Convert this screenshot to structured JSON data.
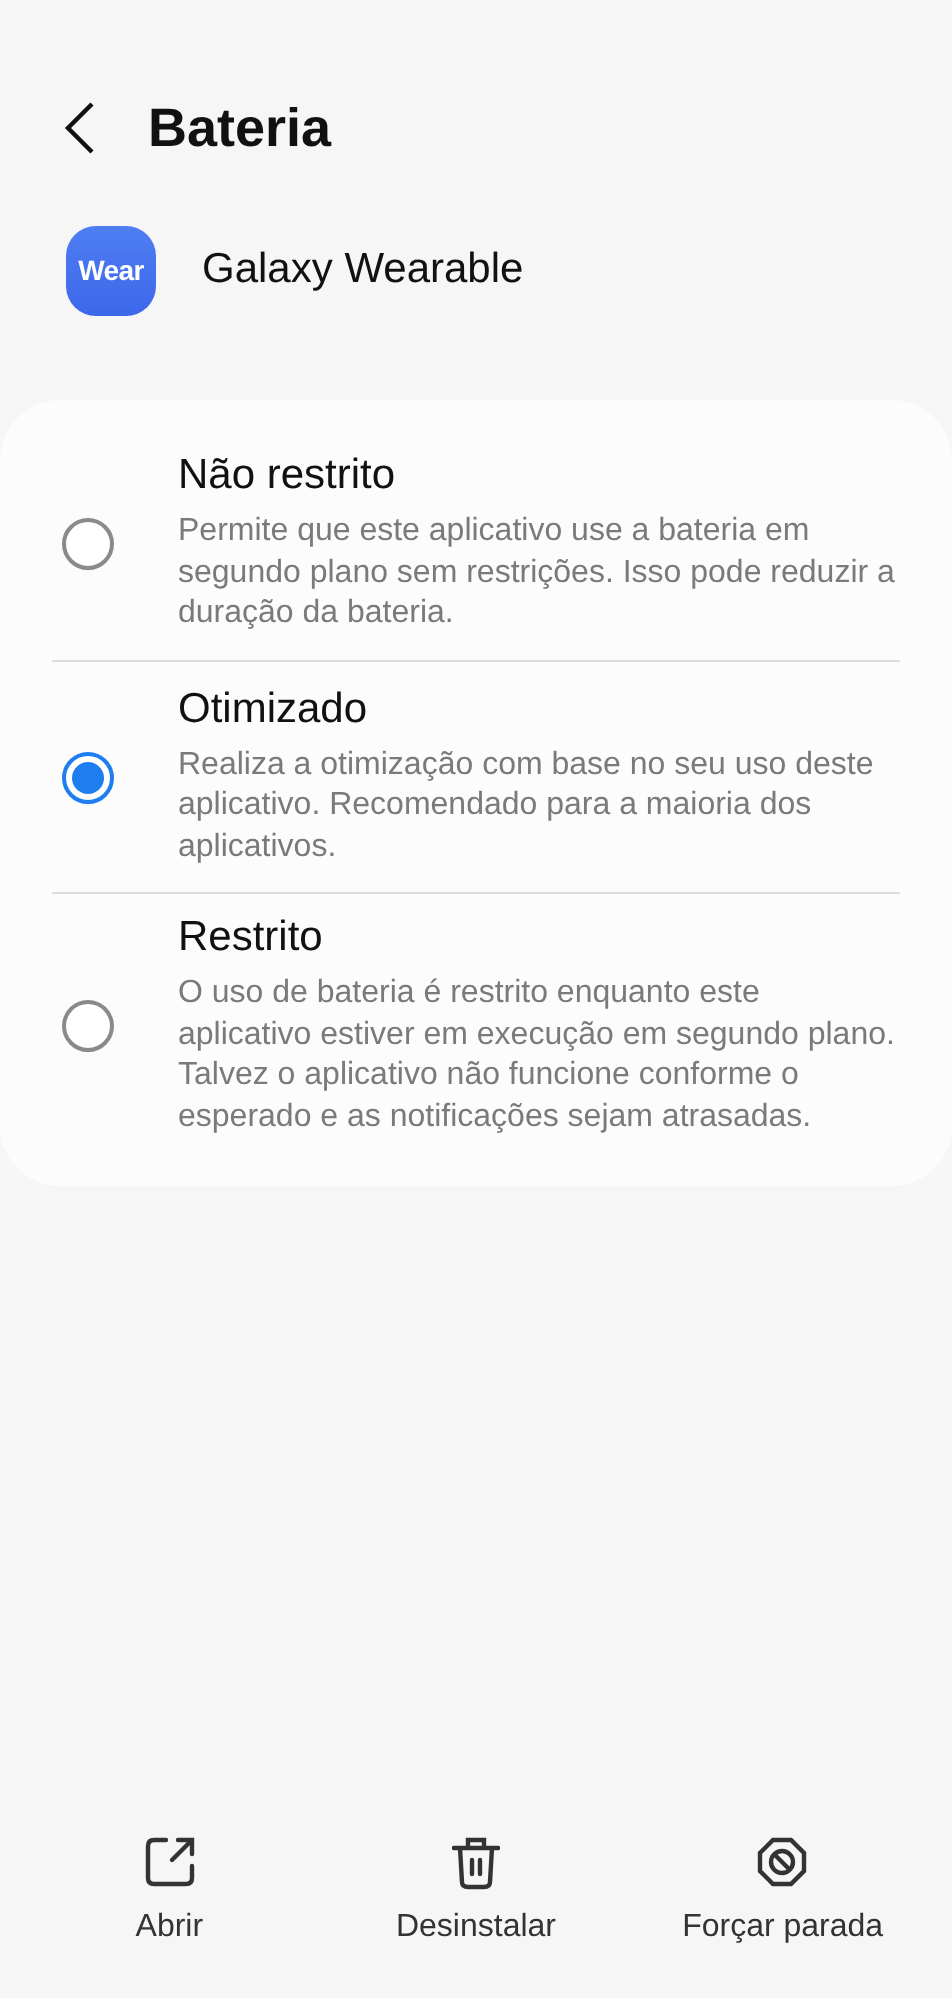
{
  "header": {
    "title": "Bateria"
  },
  "app": {
    "icon_text": "Wear",
    "name": "Galaxy Wearable"
  },
  "options": [
    {
      "title": "Não restrito",
      "description": "Permite que este aplicativo use a bateria em segundo plano sem restrições. Isso pode reduzir a duração da bateria.",
      "selected": false
    },
    {
      "title": "Otimizado",
      "description": "Realiza a otimização com base no seu uso deste aplicativo. Recomendado para a maioria dos aplicativos.",
      "selected": true
    },
    {
      "title": "Restrito",
      "description": "O uso de bateria é restrito enquanto este aplicativo estiver em execução em segundo plano. Talvez o aplicativo não funcione conforme o esperado e as notificações sejam atrasadas.",
      "selected": false
    }
  ],
  "actions": [
    {
      "kind": "open",
      "label": "Abrir"
    },
    {
      "kind": "uninstall",
      "label": "Desinstalar"
    },
    {
      "kind": "stop",
      "label": "Forçar parada"
    }
  ]
}
